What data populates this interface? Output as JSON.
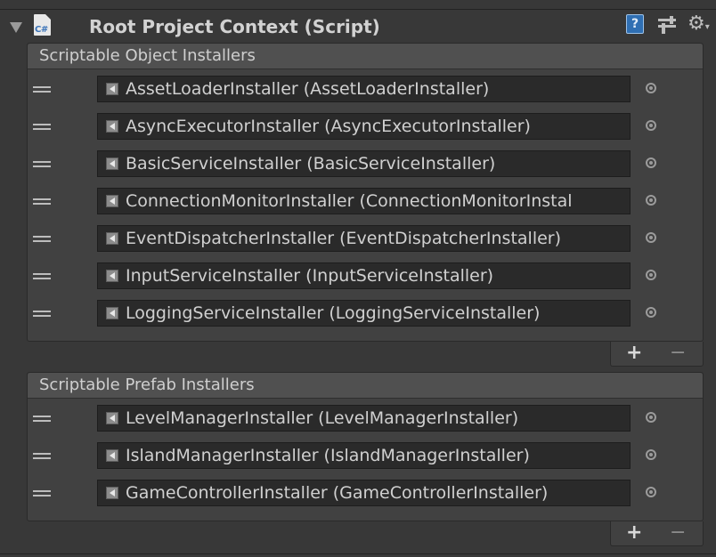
{
  "component": {
    "title": "Root Project Context (Script)",
    "script_icon_label": "C#",
    "help_icon_label": "?",
    "icons": [
      "fold-arrow-icon",
      "csharp-script-icon",
      "help-icon",
      "preset-icon",
      "gear-icon"
    ]
  },
  "scriptable_object_installers": {
    "header": "Scriptable Object Installers",
    "items": [
      "AssetLoaderInstaller (AssetLoaderInstaller)",
      "AsyncExecutorInstaller (AsyncExecutorInstaller)",
      "BasicServiceInstaller (BasicServiceInstaller)",
      "ConnectionMonitorInstaller (ConnectionMonitorInstal",
      "EventDispatcherInstaller (EventDispatcherInstaller)",
      "InputServiceInstaller (InputServiceInstaller)",
      "LoggingServiceInstaller (LoggingServiceInstaller)"
    ],
    "add_label": "+",
    "remove_label": "−"
  },
  "scriptable_prefab_installers": {
    "header": "Scriptable Prefab Installers",
    "items": [
      "LevelManagerInstaller (LevelManagerInstaller)",
      "IslandManagerInstaller (IslandManagerInstaller)",
      "GameControllerInstaller (GameControllerInstaller)"
    ],
    "add_label": "+",
    "remove_label": "−"
  }
}
